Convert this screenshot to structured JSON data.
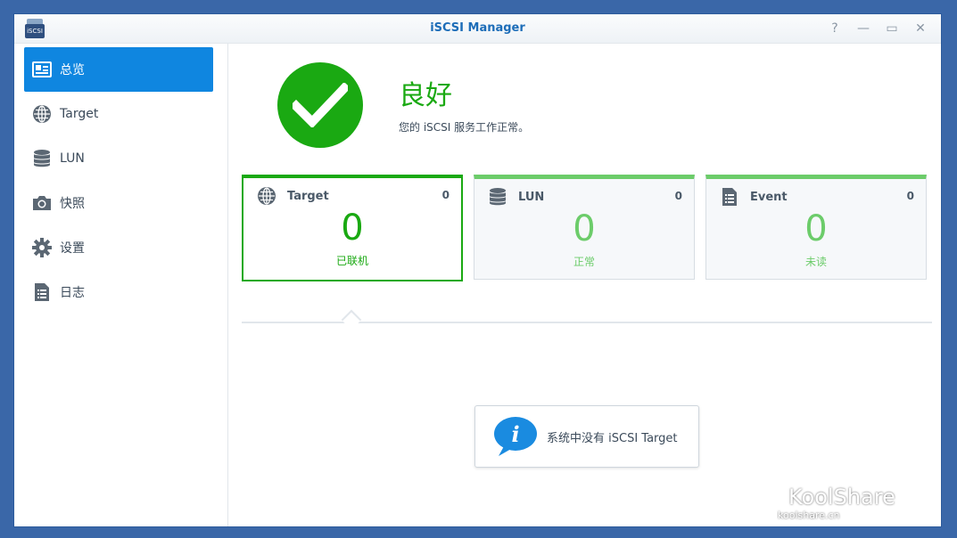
{
  "window": {
    "title": "iSCSI Manager",
    "app_icon_label": "iSCSI",
    "controls": {
      "help": "?",
      "minimize": "—",
      "maximize": "▭",
      "close": "✕"
    }
  },
  "sidebar": {
    "items": [
      {
        "label": "总览",
        "icon": "overview-icon",
        "active": true
      },
      {
        "label": "Target",
        "icon": "globe-icon",
        "active": false
      },
      {
        "label": "LUN",
        "icon": "database-icon",
        "active": false
      },
      {
        "label": "快照",
        "icon": "camera-icon",
        "active": false
      },
      {
        "label": "设置",
        "icon": "gear-icon",
        "active": false
      },
      {
        "label": "日志",
        "icon": "log-icon",
        "active": false
      }
    ]
  },
  "status": {
    "title": "良好",
    "description": "您的 iSCSI 服务工作正常。",
    "color": "#1aa912"
  },
  "cards": [
    {
      "label": "Target",
      "count": "0",
      "value": "0",
      "subtitle": "已联机",
      "icon": "globe-icon"
    },
    {
      "label": "LUN",
      "count": "0",
      "value": "0",
      "subtitle": "正常",
      "icon": "database-icon"
    },
    {
      "label": "Event",
      "count": "0",
      "value": "0",
      "subtitle": "未读",
      "icon": "document-icon"
    }
  ],
  "info": {
    "message": "系统中没有 iSCSI Target",
    "icon": "info-icon"
  },
  "watermark": {
    "brand": "KoolShare",
    "url": "koolshare.cn"
  },
  "colors": {
    "accent": "#0f86e0",
    "title": "#1d6db8",
    "success": "#1aa912",
    "success_light": "#6ccc6a"
  }
}
